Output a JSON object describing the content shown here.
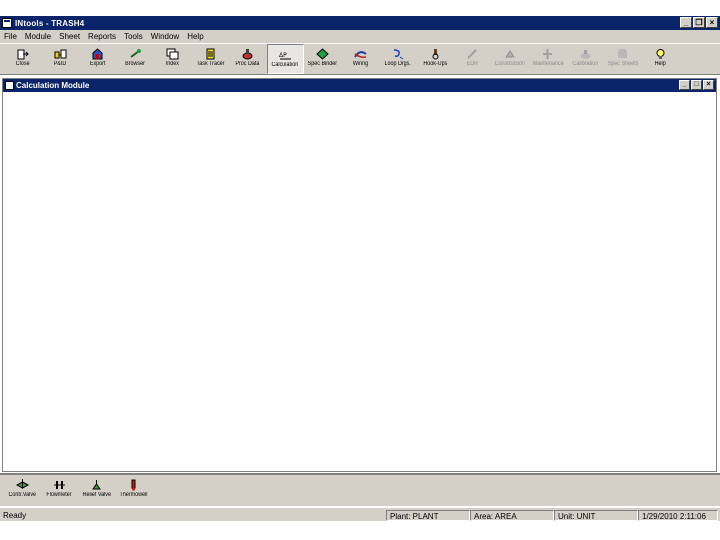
{
  "window": {
    "title": "INtools - TRASH4"
  },
  "menubar": [
    "File",
    "Module",
    "Sheet",
    "Reports",
    "Tools",
    "Window",
    "Help"
  ],
  "toolbar": [
    {
      "label": "Close",
      "icon": "door-exit-icon",
      "enabled": true
    },
    {
      "label": "P&ID",
      "icon": "pid-icon",
      "enabled": true
    },
    {
      "label": "Export",
      "icon": "export-icon",
      "enabled": true
    },
    {
      "label": "Browser",
      "icon": "browser-icon",
      "enabled": true
    },
    {
      "label": "Index",
      "icon": "index-icon",
      "enabled": true
    },
    {
      "label": "Task Tracer",
      "icon": "task-tracer-icon",
      "enabled": true
    },
    {
      "label": "Proc Data",
      "icon": "process-data-icon",
      "enabled": true
    },
    {
      "label": "Calculation",
      "icon": "calculation-icon",
      "enabled": true,
      "active": true
    },
    {
      "label": "Spec Binder",
      "icon": "spec-binder-icon",
      "enabled": true
    },
    {
      "label": "Wiring",
      "icon": "wiring-icon",
      "enabled": true
    },
    {
      "label": "Loop Drgs.",
      "icon": "loop-drawings-icon",
      "enabled": true
    },
    {
      "label": "Hook-Ups",
      "icon": "hook-ups-icon",
      "enabled": true
    },
    {
      "label": "EDR",
      "icon": "edr-icon",
      "enabled": false
    },
    {
      "label": "Construction",
      "icon": "construction-icon",
      "enabled": false
    },
    {
      "label": "Maintenance",
      "icon": "maintenance-icon",
      "enabled": false
    },
    {
      "label": "Calibration",
      "icon": "calibration-icon",
      "enabled": false
    },
    {
      "label": "Spec Sheets",
      "icon": "spec-sheets-icon",
      "enabled": false
    },
    {
      "label": "Help",
      "icon": "help-icon",
      "enabled": true
    }
  ],
  "child_window": {
    "title": "Calculation Module"
  },
  "bottom_toolbar": [
    {
      "label": "Contr.Valve",
      "icon": "control-valve-icon"
    },
    {
      "label": "Flowmeter",
      "icon": "flowmeter-icon"
    },
    {
      "label": "Relief Valve",
      "icon": "relief-valve-icon"
    },
    {
      "label": "Thermowell",
      "icon": "thermowell-icon"
    }
  ],
  "statusbar": {
    "ready": "Ready",
    "plant": "Plant: PLANT",
    "area": "Area: AREA",
    "unit": "Unit: UNIT",
    "datetime": "1/29/2010 2:11:06"
  },
  "colors": {
    "titlebar": "#0a246a",
    "chrome": "#d4d0c8"
  }
}
